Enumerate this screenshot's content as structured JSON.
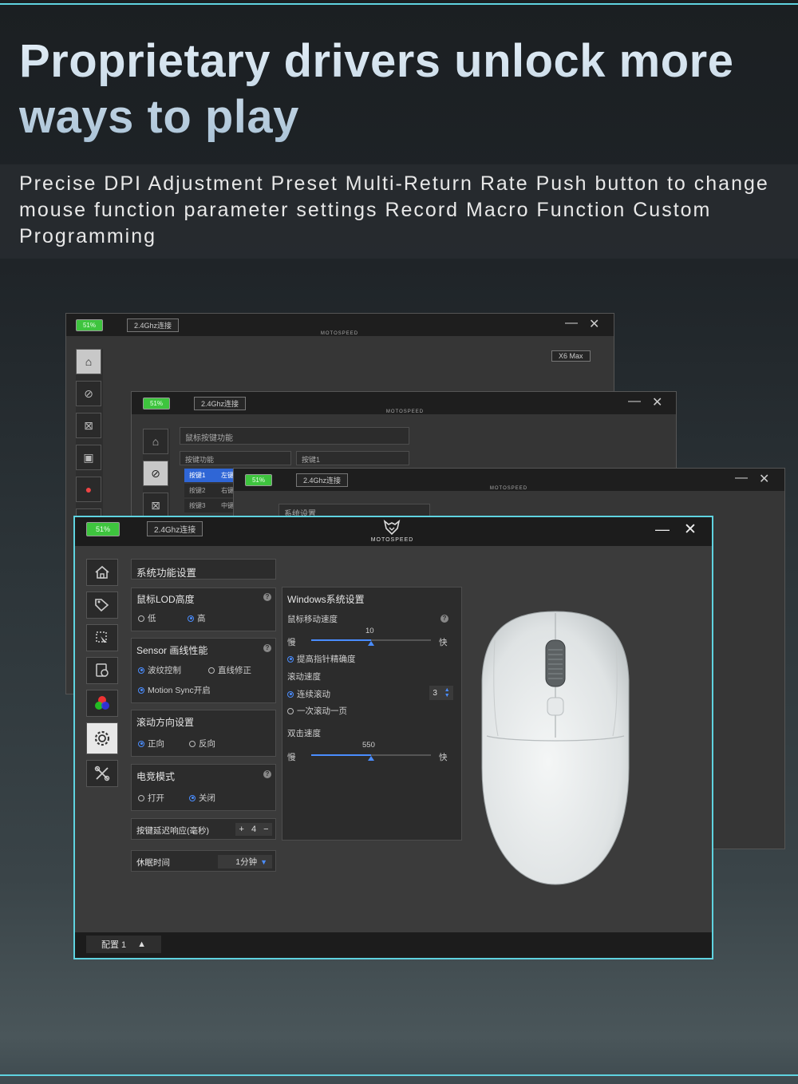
{
  "hero": {
    "title": "Proprietary drivers unlock more ways to play",
    "subtitle": "Precise DPI Adjustment Preset Multi-Return Rate Push button to change mouse function parameter settings Record Macro Function Custom Programming"
  },
  "colors": {
    "accent": "#5fd3e0",
    "battery": "#3ec43e",
    "select": "#4a8dff"
  },
  "windows": {
    "battery": "51%",
    "connection": "2.4Ghz连接",
    "brand": "MOTOSPEED",
    "model": "X6 Max",
    "back2": {
      "panel_title": "鼠标按键功能",
      "col1": "按键功能",
      "col2": "按键1",
      "rows": [
        "按键1",
        "按键2",
        "按键3"
      ],
      "row_vals": [
        "左键",
        "右键",
        "中键"
      ]
    },
    "back3": {
      "panel_title": "系统设置"
    }
  },
  "sidebar": {
    "icons": [
      "home-icon",
      "tag-icon",
      "macro-icon",
      "profile-icon",
      "rgb-icon",
      "settings-icon",
      "tools-icon"
    ],
    "active_index": 5
  },
  "front": {
    "section_title": "系统功能设置",
    "lod": {
      "title": "鼠标LOD高度",
      "opt_low": "低",
      "opt_high": "高",
      "selected": "高"
    },
    "sensor": {
      "title": "Sensor 画线性能",
      "opt_ripple": "波纹控制",
      "opt_angle": "直线修正",
      "opt_motion": "Motion Sync开启"
    },
    "scroll_dir": {
      "title": "滚动方向设置",
      "opt_forward": "正向",
      "opt_reverse": "反向",
      "selected": "正向"
    },
    "esports": {
      "title": "电竞模式",
      "opt_on": "打开",
      "opt_off": "关闭",
      "selected": "关闭"
    },
    "debounce": {
      "label": "按键延迟响应(毫秒)",
      "plus": "+",
      "value": "4",
      "minus": "−"
    },
    "sleep": {
      "label": "休眠时间",
      "value": "1分钟"
    },
    "windows_settings": {
      "title": "Windows系统设置",
      "pointer_speed": {
        "label": "鼠标移动速度",
        "slow": "慢",
        "fast": "快",
        "value": "10",
        "fraction": 0.5
      },
      "precision": "提高指针精确度",
      "scroll_speed": {
        "label": "滚动速度",
        "opt_lines": "连续滚动",
        "lines_value": "3",
        "opt_page": "一次滚动一页"
      },
      "double_click": {
        "label": "双击速度",
        "slow": "慢",
        "fast": "快",
        "value": "550",
        "fraction": 0.5
      }
    },
    "profile": "配置 1"
  }
}
